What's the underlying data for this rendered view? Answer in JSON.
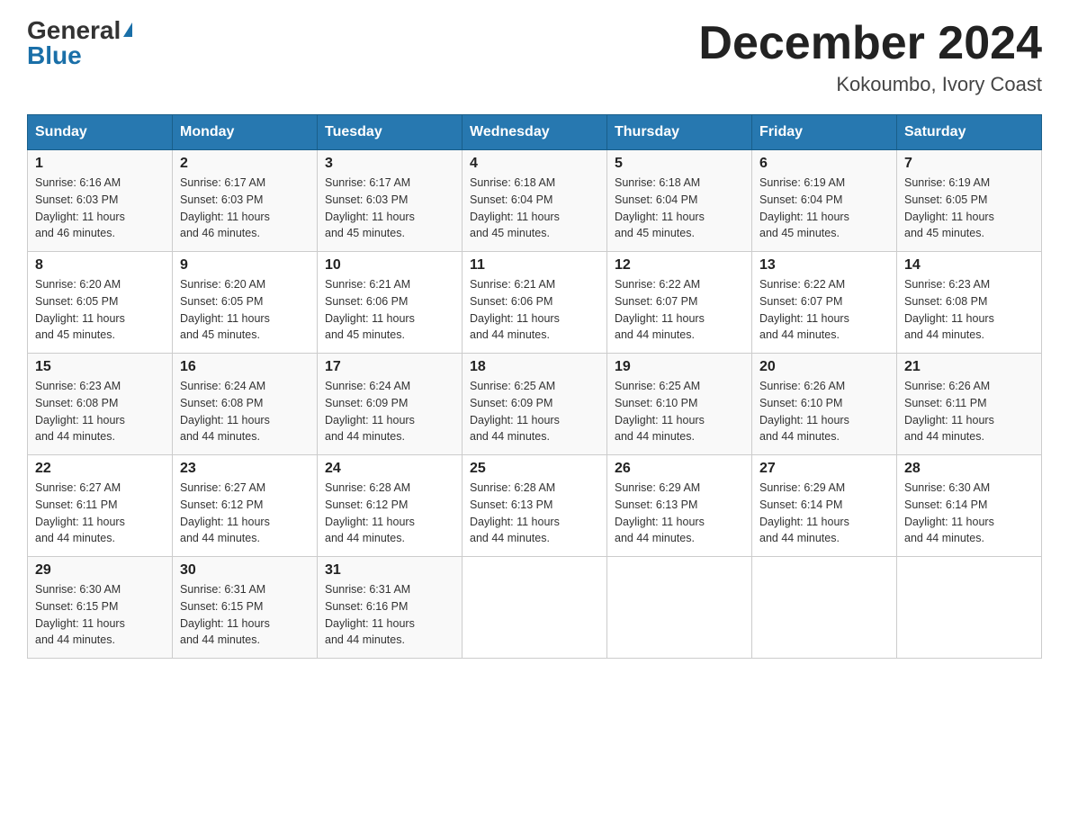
{
  "logo": {
    "general": "General",
    "blue": "Blue"
  },
  "header": {
    "month": "December 2024",
    "location": "Kokoumbo, Ivory Coast"
  },
  "days_of_week": [
    "Sunday",
    "Monday",
    "Tuesday",
    "Wednesday",
    "Thursday",
    "Friday",
    "Saturday"
  ],
  "weeks": [
    [
      {
        "day": "1",
        "sunrise": "6:16 AM",
        "sunset": "6:03 PM",
        "daylight": "11 hours and 46 minutes."
      },
      {
        "day": "2",
        "sunrise": "6:17 AM",
        "sunset": "6:03 PM",
        "daylight": "11 hours and 46 minutes."
      },
      {
        "day": "3",
        "sunrise": "6:17 AM",
        "sunset": "6:03 PM",
        "daylight": "11 hours and 45 minutes."
      },
      {
        "day": "4",
        "sunrise": "6:18 AM",
        "sunset": "6:04 PM",
        "daylight": "11 hours and 45 minutes."
      },
      {
        "day": "5",
        "sunrise": "6:18 AM",
        "sunset": "6:04 PM",
        "daylight": "11 hours and 45 minutes."
      },
      {
        "day": "6",
        "sunrise": "6:19 AM",
        "sunset": "6:04 PM",
        "daylight": "11 hours and 45 minutes."
      },
      {
        "day": "7",
        "sunrise": "6:19 AM",
        "sunset": "6:05 PM",
        "daylight": "11 hours and 45 minutes."
      }
    ],
    [
      {
        "day": "8",
        "sunrise": "6:20 AM",
        "sunset": "6:05 PM",
        "daylight": "11 hours and 45 minutes."
      },
      {
        "day": "9",
        "sunrise": "6:20 AM",
        "sunset": "6:05 PM",
        "daylight": "11 hours and 45 minutes."
      },
      {
        "day": "10",
        "sunrise": "6:21 AM",
        "sunset": "6:06 PM",
        "daylight": "11 hours and 45 minutes."
      },
      {
        "day": "11",
        "sunrise": "6:21 AM",
        "sunset": "6:06 PM",
        "daylight": "11 hours and 44 minutes."
      },
      {
        "day": "12",
        "sunrise": "6:22 AM",
        "sunset": "6:07 PM",
        "daylight": "11 hours and 44 minutes."
      },
      {
        "day": "13",
        "sunrise": "6:22 AM",
        "sunset": "6:07 PM",
        "daylight": "11 hours and 44 minutes."
      },
      {
        "day": "14",
        "sunrise": "6:23 AM",
        "sunset": "6:08 PM",
        "daylight": "11 hours and 44 minutes."
      }
    ],
    [
      {
        "day": "15",
        "sunrise": "6:23 AM",
        "sunset": "6:08 PM",
        "daylight": "11 hours and 44 minutes."
      },
      {
        "day": "16",
        "sunrise": "6:24 AM",
        "sunset": "6:08 PM",
        "daylight": "11 hours and 44 minutes."
      },
      {
        "day": "17",
        "sunrise": "6:24 AM",
        "sunset": "6:09 PM",
        "daylight": "11 hours and 44 minutes."
      },
      {
        "day": "18",
        "sunrise": "6:25 AM",
        "sunset": "6:09 PM",
        "daylight": "11 hours and 44 minutes."
      },
      {
        "day": "19",
        "sunrise": "6:25 AM",
        "sunset": "6:10 PM",
        "daylight": "11 hours and 44 minutes."
      },
      {
        "day": "20",
        "sunrise": "6:26 AM",
        "sunset": "6:10 PM",
        "daylight": "11 hours and 44 minutes."
      },
      {
        "day": "21",
        "sunrise": "6:26 AM",
        "sunset": "6:11 PM",
        "daylight": "11 hours and 44 minutes."
      }
    ],
    [
      {
        "day": "22",
        "sunrise": "6:27 AM",
        "sunset": "6:11 PM",
        "daylight": "11 hours and 44 minutes."
      },
      {
        "day": "23",
        "sunrise": "6:27 AM",
        "sunset": "6:12 PM",
        "daylight": "11 hours and 44 minutes."
      },
      {
        "day": "24",
        "sunrise": "6:28 AM",
        "sunset": "6:12 PM",
        "daylight": "11 hours and 44 minutes."
      },
      {
        "day": "25",
        "sunrise": "6:28 AM",
        "sunset": "6:13 PM",
        "daylight": "11 hours and 44 minutes."
      },
      {
        "day": "26",
        "sunrise": "6:29 AM",
        "sunset": "6:13 PM",
        "daylight": "11 hours and 44 minutes."
      },
      {
        "day": "27",
        "sunrise": "6:29 AM",
        "sunset": "6:14 PM",
        "daylight": "11 hours and 44 minutes."
      },
      {
        "day": "28",
        "sunrise": "6:30 AM",
        "sunset": "6:14 PM",
        "daylight": "11 hours and 44 minutes."
      }
    ],
    [
      {
        "day": "29",
        "sunrise": "6:30 AM",
        "sunset": "6:15 PM",
        "daylight": "11 hours and 44 minutes."
      },
      {
        "day": "30",
        "sunrise": "6:31 AM",
        "sunset": "6:15 PM",
        "daylight": "11 hours and 44 minutes."
      },
      {
        "day": "31",
        "sunrise": "6:31 AM",
        "sunset": "6:16 PM",
        "daylight": "11 hours and 44 minutes."
      },
      null,
      null,
      null,
      null
    ]
  ],
  "labels": {
    "sunrise": "Sunrise:",
    "sunset": "Sunset:",
    "daylight": "Daylight:"
  }
}
